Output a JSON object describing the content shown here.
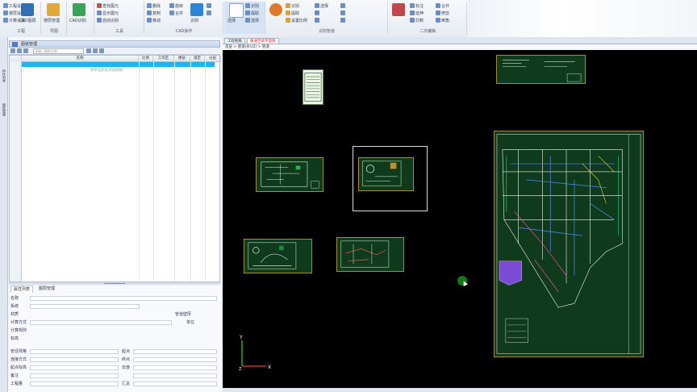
{
  "ribbon": {
    "groups": [
      {
        "label": "工程",
        "items": [
          "工程设置",
          "楼层设置",
          "计算设置"
        ]
      },
      {
        "label": "导图",
        "items": [
          "CAD识别",
          "识别楼层"
        ]
      },
      {
        "label": "工具",
        "items": [
          "查找图元",
          "显示图元",
          "自动识别"
        ]
      },
      {
        "label": "CAD操作",
        "items": [
          "删除",
          "复制",
          "移动",
          "旋转",
          "合并"
        ]
      },
      {
        "label": "识别",
        "items": [
          "识别",
          "提取",
          "选择"
        ]
      },
      {
        "label": "识别管道",
        "items": [
          "识别",
          "提取",
          "设置比例",
          "选择"
        ]
      },
      {
        "label": "二次编辑",
        "items": [
          "标注",
          "延伸",
          "打断",
          "合并",
          "修剪",
          "倒角"
        ]
      }
    ],
    "big_buttons": [
      "CAD图层",
      "楼层管理",
      "识别",
      "选择"
    ]
  },
  "left_panel": {
    "tabs": [
      "构件列表",
      "图纸管理"
    ],
    "title": "图纸管理",
    "search_placeholder": "请输入图纸名称",
    "grid_headers": [
      "名称",
      "比例",
      "工作区",
      "楼层",
      "锁定",
      "分层"
    ],
    "empty_hint": "请单击此处添加图纸",
    "prop_tabs": [
      "属性列表",
      "图层管理"
    ],
    "props": [
      {
        "label": "名称",
        "value": ""
      },
      {
        "label": "系统",
        "value": ""
      },
      {
        "label": "材质",
        "value": "",
        "right_label": "管道壁厚",
        "right_value": ""
      },
      {
        "label": "计算方式",
        "value": "",
        "right_label": "单位",
        "right_value": ""
      },
      {
        "label": "计算规则",
        "value": ""
      },
      {
        "label": "标高",
        "value": ""
      },
      {
        "label": "管径规格",
        "value": "",
        "right_label": "起点",
        "right_value": ""
      },
      {
        "label": "连接方式",
        "value": "",
        "right_label": "终点",
        "right_value": ""
      },
      {
        "label": "起点标高",
        "value": "",
        "right_label": "长度",
        "right_value": ""
      },
      {
        "label": "备注",
        "value": "",
        "right_label": "",
        "right_value": ""
      },
      {
        "label": "工程量",
        "value": "",
        "right_label": "汇总",
        "right_value": ""
      }
    ]
  },
  "canvas": {
    "doc_tabs": [
      "工程图纸",
      "暖通空调平面图",
      "给排水"
    ],
    "active_tab_index": 1,
    "breadcrumb": "首层 > 管道(水)(Z) > 管道",
    "axis": {
      "y_label": "Y",
      "x_label": "X",
      "z_label": "Z"
    }
  },
  "colors": {
    "accent": "#1fb4ec",
    "sheet_bg": "#0f3b1c",
    "sheet_border": "#b08a2a",
    "canvas_bg": "#000000",
    "pipe_purple": "#7b4bd6"
  }
}
